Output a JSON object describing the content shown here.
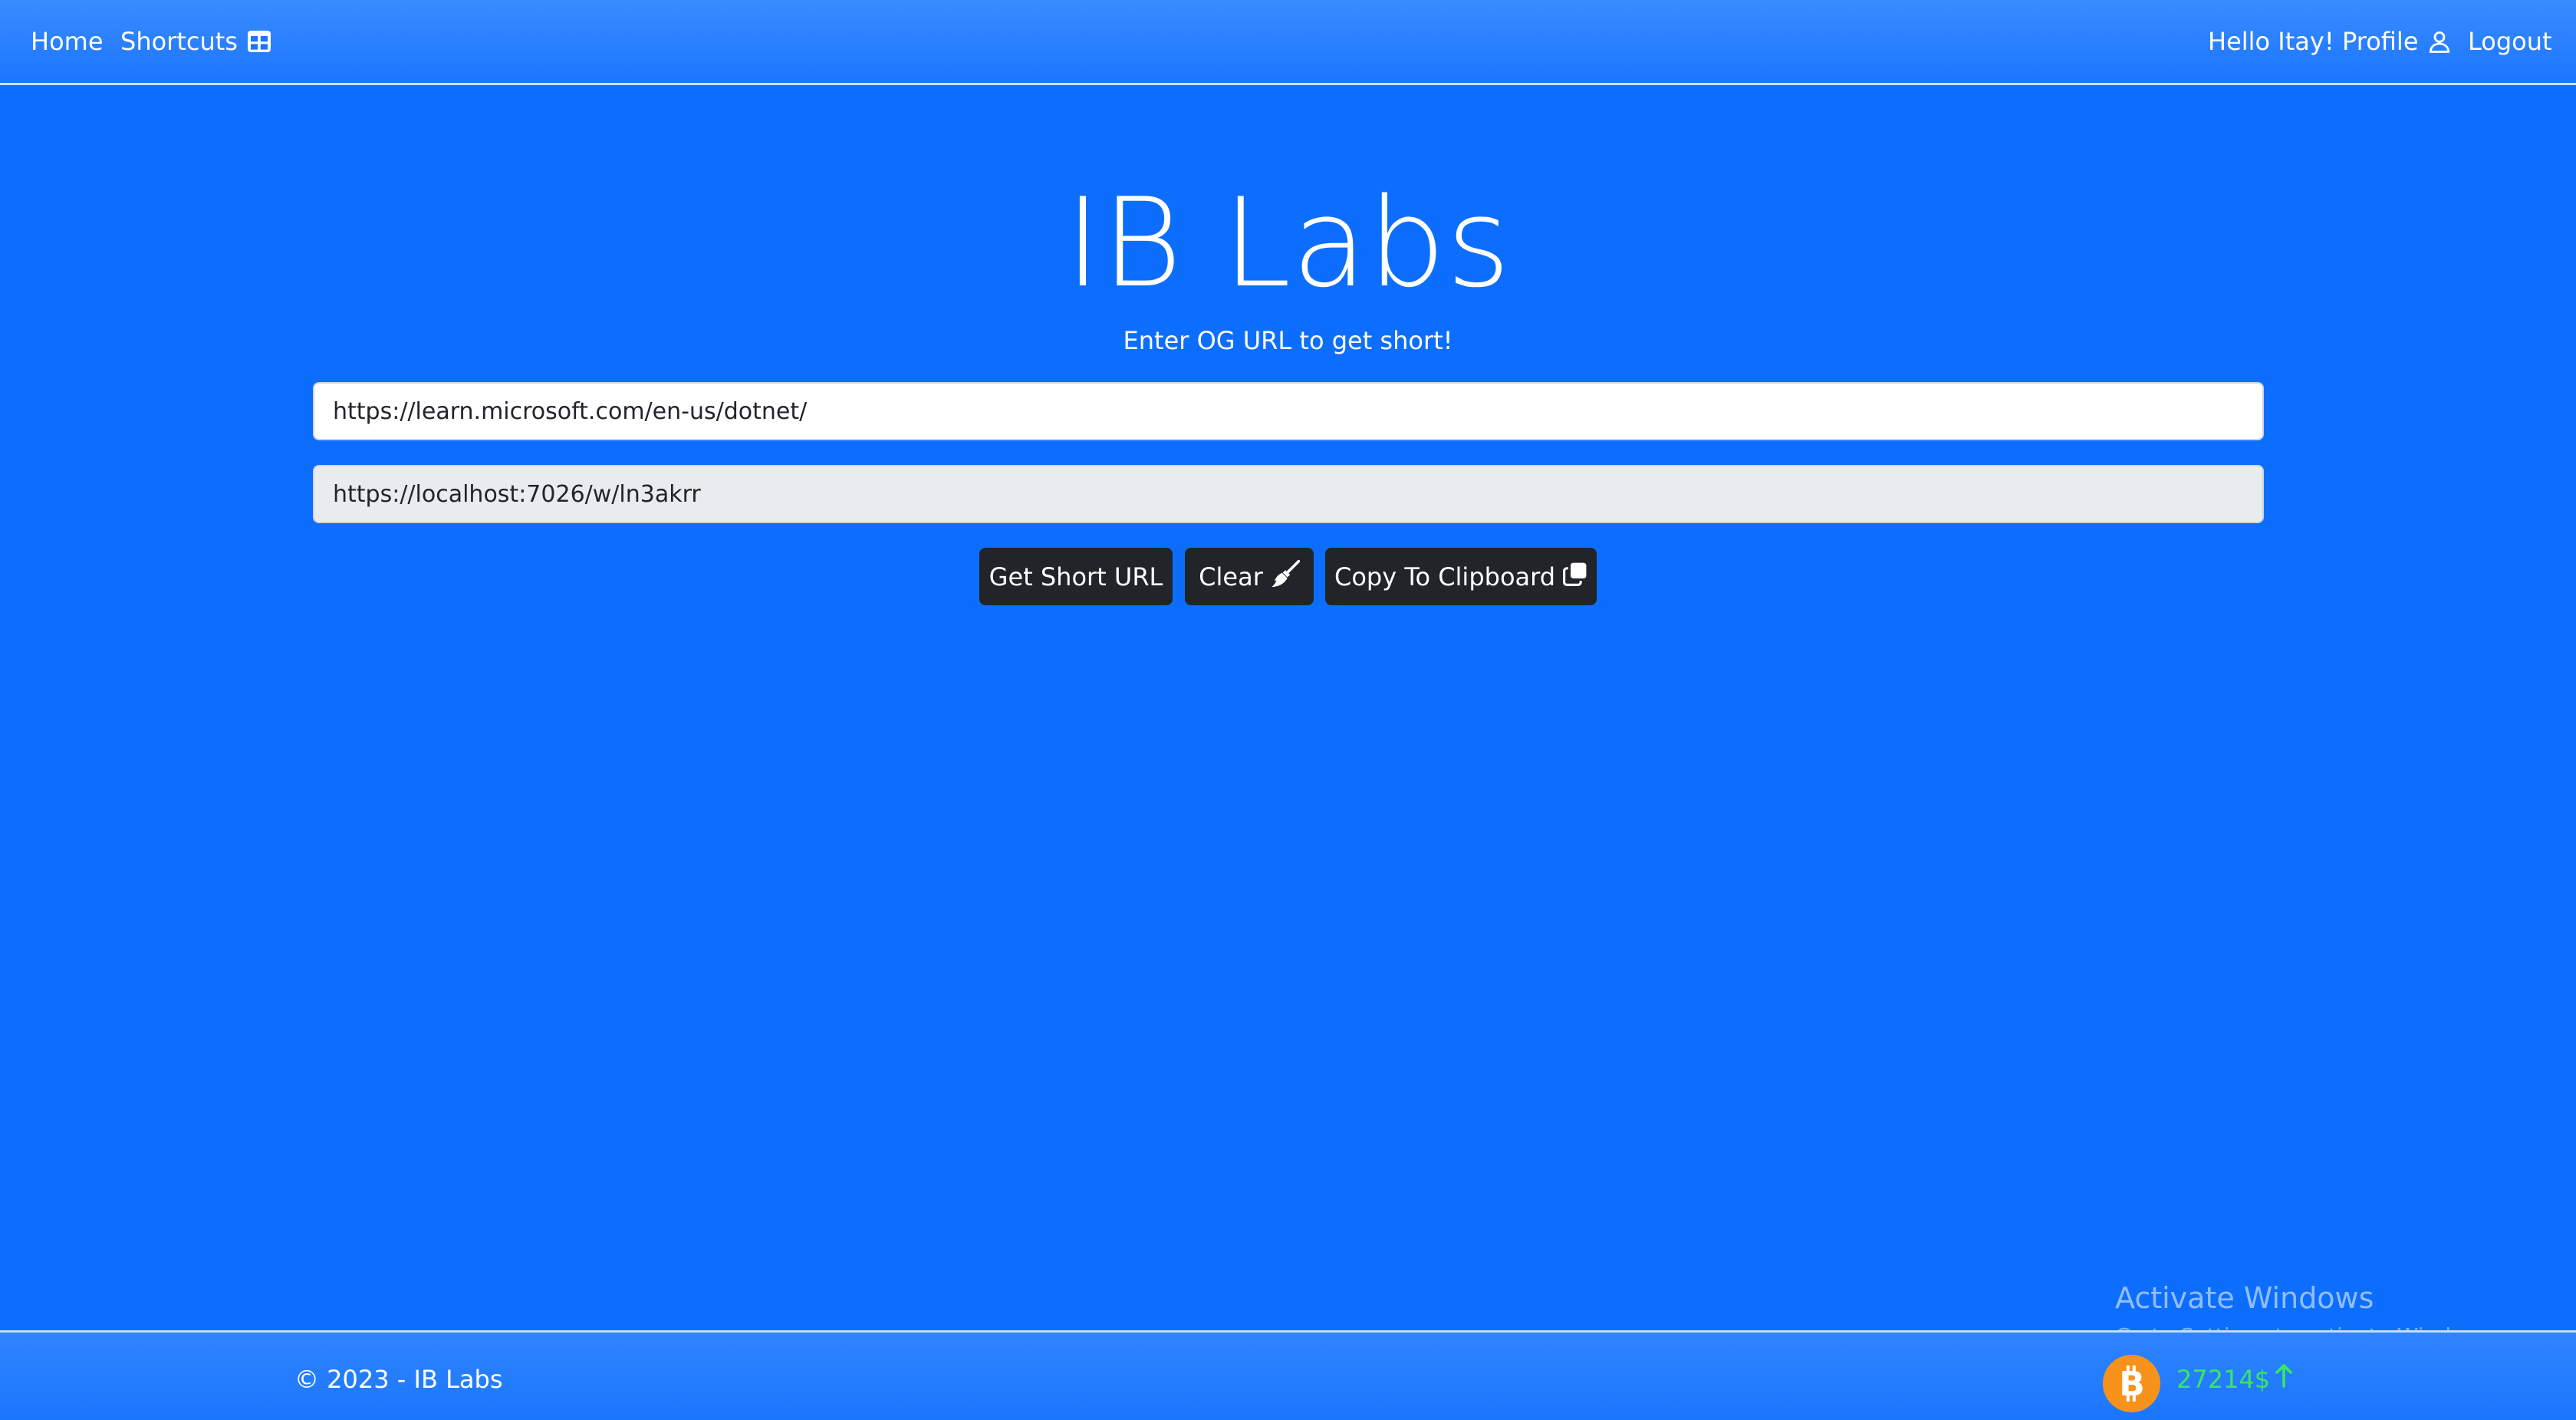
{
  "navbar": {
    "home_label": "Home",
    "shortcuts_label": "Shortcuts",
    "greeting": "Hello Itay!",
    "profile_label": "Profile",
    "logout_label": "Logout"
  },
  "hero": {
    "title": "IB Labs",
    "subtitle": "Enter OG URL to get short!"
  },
  "form": {
    "og_url_value": "https://learn.microsoft.com/en-us/dotnet/",
    "short_url_value": "https://localhost:7026/w/ln3akrr"
  },
  "buttons": {
    "get_short_label": "Get Short URL",
    "clear_label": "Clear",
    "copy_label": "Copy To Clipboard"
  },
  "footer": {
    "copyright": "© 2023 - IB Labs",
    "btc_price": "27214$",
    "btc_trend": "up"
  },
  "watermark": {
    "title": "Activate Windows",
    "subtitle": "Go to Settings to activate Windows."
  },
  "icons": {
    "shortcuts": "table-icon",
    "profile": "person-icon",
    "clear": "broom-icon",
    "copy": "copy-icon",
    "btc": "bitcoin-icon",
    "trend": "arrow-up-icon"
  },
  "colors": {
    "background": "#0d6efd",
    "button": "#212529",
    "btc_orange": "#f7931a",
    "price_green": "#39e75f"
  }
}
